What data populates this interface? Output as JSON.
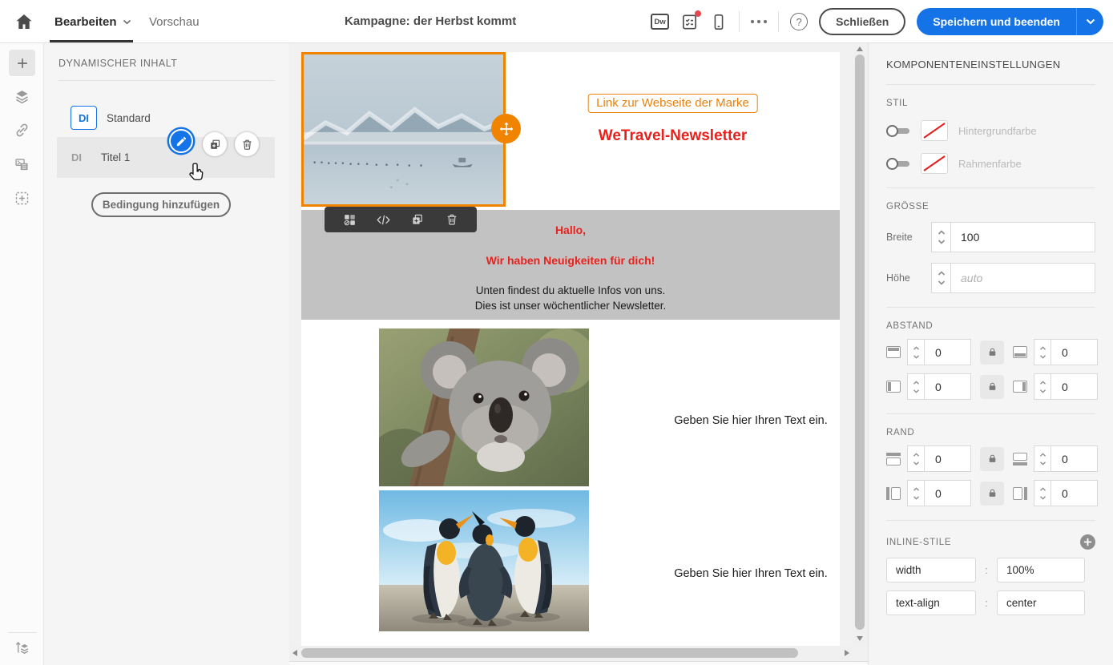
{
  "topbar": {
    "tab_bearbeiten": "Bearbeiten",
    "tab_vorschau": "Vorschau",
    "title": "Kampagne: der Herbst kommt",
    "dw_badge": "Dw",
    "help_label": "?",
    "close_label": "Schließen",
    "save_label": "Speichern und beenden"
  },
  "left_panel": {
    "heading": "DYNAMISCHER INHALT",
    "items": [
      {
        "badge": "DI",
        "label": "Standard"
      },
      {
        "badge": "DI",
        "label": "Titel 1"
      }
    ],
    "add_condition_label": "Bedingung hinzufügen"
  },
  "email": {
    "link_button": "Link zur Webseite der Marke",
    "newsletter_title": "WeTravel-Newsletter",
    "greeting": "Hallo,",
    "subtitle": "Wir haben Neuigkeiten für dich!",
    "body_line1": "Unten findest du aktuelle Infos von uns.",
    "body_line2": "Dies ist unser wöchentlicher Newsletter.",
    "row1_text": "Geben Sie hier Ihren Text ein.",
    "row2_text": "Geben Sie hier Ihren Text ein."
  },
  "right_panel": {
    "heading": "KOMPONENTENEINSTELLUNGEN",
    "stil": {
      "label": "STIL",
      "background_label": "Hintergrundfarbe",
      "border_label": "Rahmenfarbe"
    },
    "groesse": {
      "label": "GRÖSSE",
      "width_label": "Breite",
      "width_value": "100",
      "height_label": "Höhe",
      "height_placeholder": "auto"
    },
    "abstand": {
      "label": "ABSTAND",
      "values": [
        "0",
        "0",
        "0",
        "0"
      ]
    },
    "rand": {
      "label": "RAND",
      "values": [
        "0",
        "0",
        "0",
        "0"
      ]
    },
    "inline": {
      "label": "INLINE-STILE",
      "rows": [
        {
          "property": "width",
          "value": "100%"
        },
        {
          "property": "text-align",
          "value": "center"
        }
      ]
    }
  },
  "colors": {
    "accent_blue": "#1473e6",
    "selection_orange": "#f08300",
    "email_red": "#e8211d",
    "link_orange": "#e8820c",
    "band_gray": "#c2c2c2"
  }
}
